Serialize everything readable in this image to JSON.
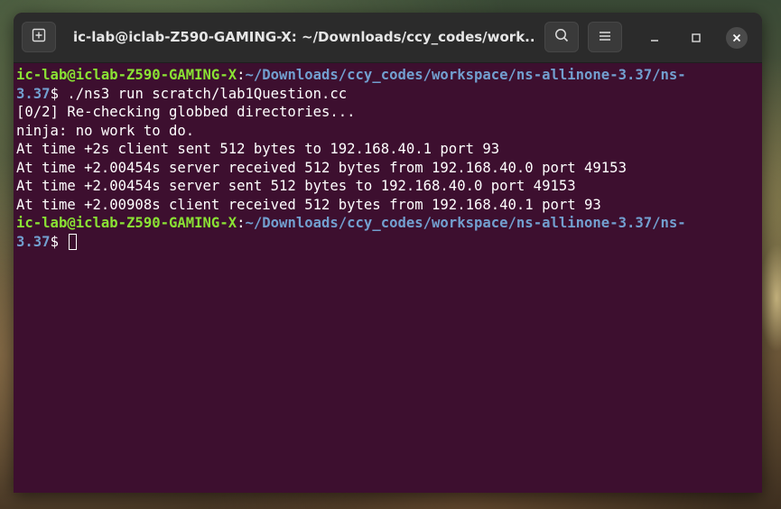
{
  "window": {
    "title": "ic-lab@iclab-Z590-GAMING-X: ~/Downloads/ccy_codes/work..."
  },
  "icons": {
    "new_tab": "new-tab-icon",
    "search": "search-icon",
    "menu": "hamburger-menu-icon",
    "minimize": "minimize-icon",
    "maximize": "maximize-icon",
    "close": "close-icon"
  },
  "colors": {
    "terminal_bg": "#3d0f2f",
    "prompt_user": "#8ae234",
    "prompt_path": "#729fcf",
    "titlebar_bg": "#2b2b2b"
  },
  "terminal": {
    "prompt1": {
      "user": "ic-lab@iclab-Z590-GAMING-X",
      "sep": ":",
      "path_a": "~/Downloads/ccy_codes/workspace/ns-allinone-3.37/ns-",
      "path_b": "3.37",
      "symbol": "$ ",
      "command": "./ns3 run scratch/lab1Question.cc"
    },
    "output": [
      "[0/2] Re-checking globbed directories...",
      "ninja: no work to do.",
      "At time +2s client sent 512 bytes to 192.168.40.1 port 93",
      "At time +2.00454s server received 512 bytes from 192.168.40.0 port 49153",
      "At time +2.00454s server sent 512 bytes to 192.168.40.0 port 49153",
      "At time +2.00908s client received 512 bytes from 192.168.40.1 port 93"
    ],
    "prompt2": {
      "user": "ic-lab@iclab-Z590-GAMING-X",
      "sep": ":",
      "path_a": "~/Downloads/ccy_codes/workspace/ns-allinone-3.37/ns-",
      "path_b": "3.37",
      "symbol": "$ "
    }
  }
}
